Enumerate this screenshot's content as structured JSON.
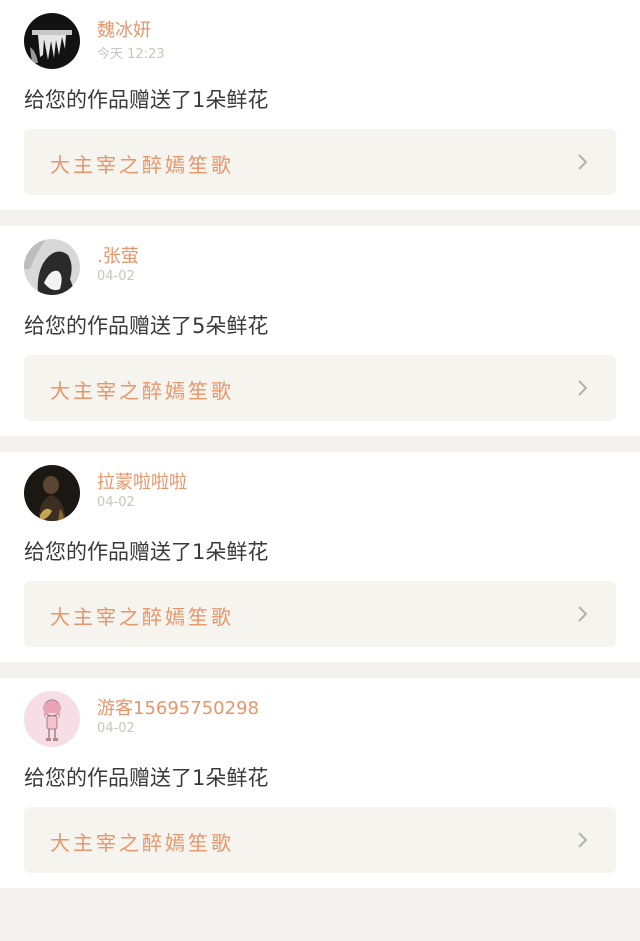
{
  "items": [
    {
      "name": "魏冰妍",
      "time": "今天 12:23",
      "message": "给您的作品赠送了1朵鲜花",
      "work_title": "大主宰之醉嫣笙歌",
      "avatar_icon": "dark-figure-avatar-icon"
    },
    {
      "name": ".张萤",
      "time": "04-02",
      "message": "给您的作品赠送了5朵鲜花",
      "work_title": "大主宰之醉嫣笙歌",
      "avatar_icon": "girl-silhouette-avatar-icon"
    },
    {
      "name": "拉蒙啦啦啦",
      "time": "04-02",
      "message": "给您的作品赠送了1朵鲜花",
      "work_title": "大主宰之醉嫣笙歌",
      "avatar_icon": "dark-portrait-avatar-icon"
    },
    {
      "name": "游客15695750298",
      "time": "04-02",
      "message": "给您的作品赠送了1朵鲜花",
      "work_title": "大主宰之醉嫣笙歌",
      "avatar_icon": "pink-girl-avatar-icon"
    }
  ],
  "colors": {
    "accent": "#e8956a",
    "muted": "#c9c5c0",
    "text": "#3a3a3a",
    "work_bg": "#f6f4ee",
    "page_bg": "#f4f2ef"
  }
}
